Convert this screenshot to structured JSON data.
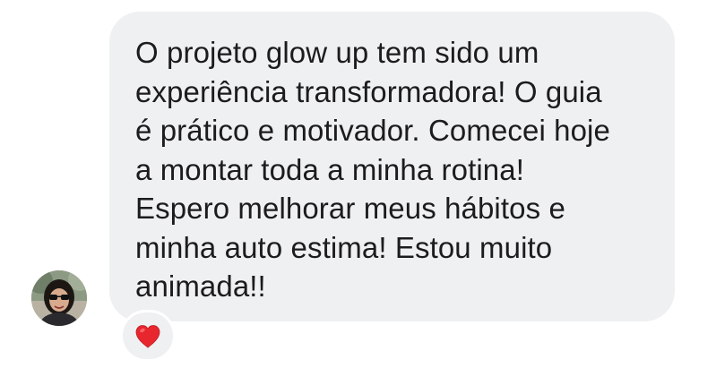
{
  "message": {
    "text": "O projeto glow up tem sido um\nexperiência transformadora! O guia\né prático e motivador. Comecei hoje\na montar toda a minha rotina!\nEspero melhorar meus hábitos e\nminha auto estima! Estou muito\nanimada!!"
  },
  "reaction": {
    "icon": "heart-icon",
    "color": "#e8262d"
  },
  "avatar": {
    "icon": "user-avatar"
  },
  "colors": {
    "bubble": "#eff0f2",
    "text": "#1c1c1e"
  }
}
